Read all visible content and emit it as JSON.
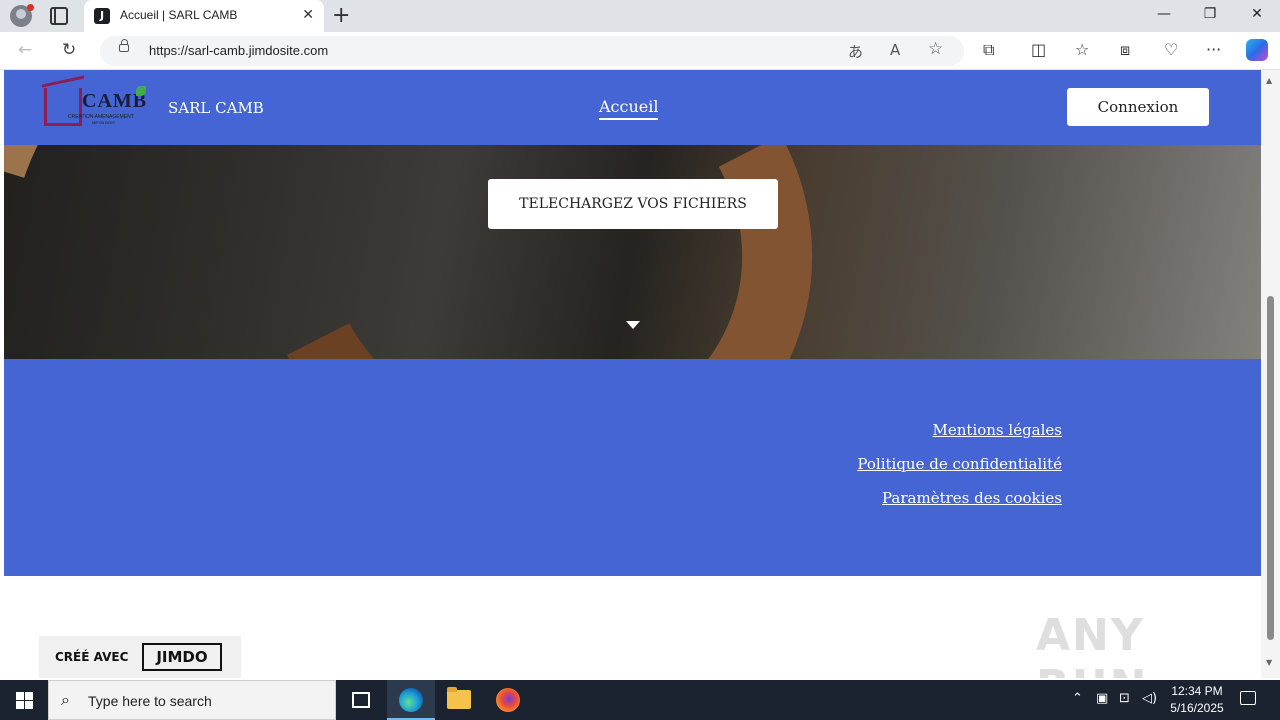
{
  "browser": {
    "tab_title": "Accueil | SARL CAMB",
    "tab_favicon_letter": "J",
    "tab_close": "✕",
    "new_tab": "+",
    "url": "https://sarl-camb.jimdosite.com",
    "window_controls": {
      "minimize": "—",
      "restore": "❐",
      "close": "✕"
    },
    "nav": {
      "back": "←",
      "reload": "↻"
    },
    "omnibox_icons": {
      "translate": "あ",
      "read_aloud": "A",
      "favorite": "☆"
    },
    "toolbar_icons": {
      "extensions": "⧉",
      "split": "◫",
      "favorites": "☆",
      "collections": "⧈",
      "performance": "♡",
      "more": "···"
    }
  },
  "site": {
    "logo_text": "CAMB",
    "logo_subtitle": "CREATION AMENAGEMENT",
    "logo_subtitle2": "MEYAI BOIS",
    "name": "SARL CAMB",
    "nav_active": "Accueil",
    "login_label": "Connexion",
    "hero_button": "TELECHARGEZ VOS FICHIERS",
    "footer_links": [
      "Mentions légales",
      "Politique de confidentialité",
      "Paramètres des cookies"
    ],
    "badge_label": "CRÉÉ AVEC",
    "badge_brand": "JIMDO",
    "colors": {
      "brand_blue": "#4465d3",
      "white": "#ffffff"
    }
  },
  "watermark": "ANY RUN",
  "taskbar": {
    "search_placeholder": "Type here to search",
    "time": "12:34 PM",
    "date": "5/16/2025",
    "tray_icons": [
      "chevron-up",
      "meet",
      "network",
      "volume"
    ]
  }
}
